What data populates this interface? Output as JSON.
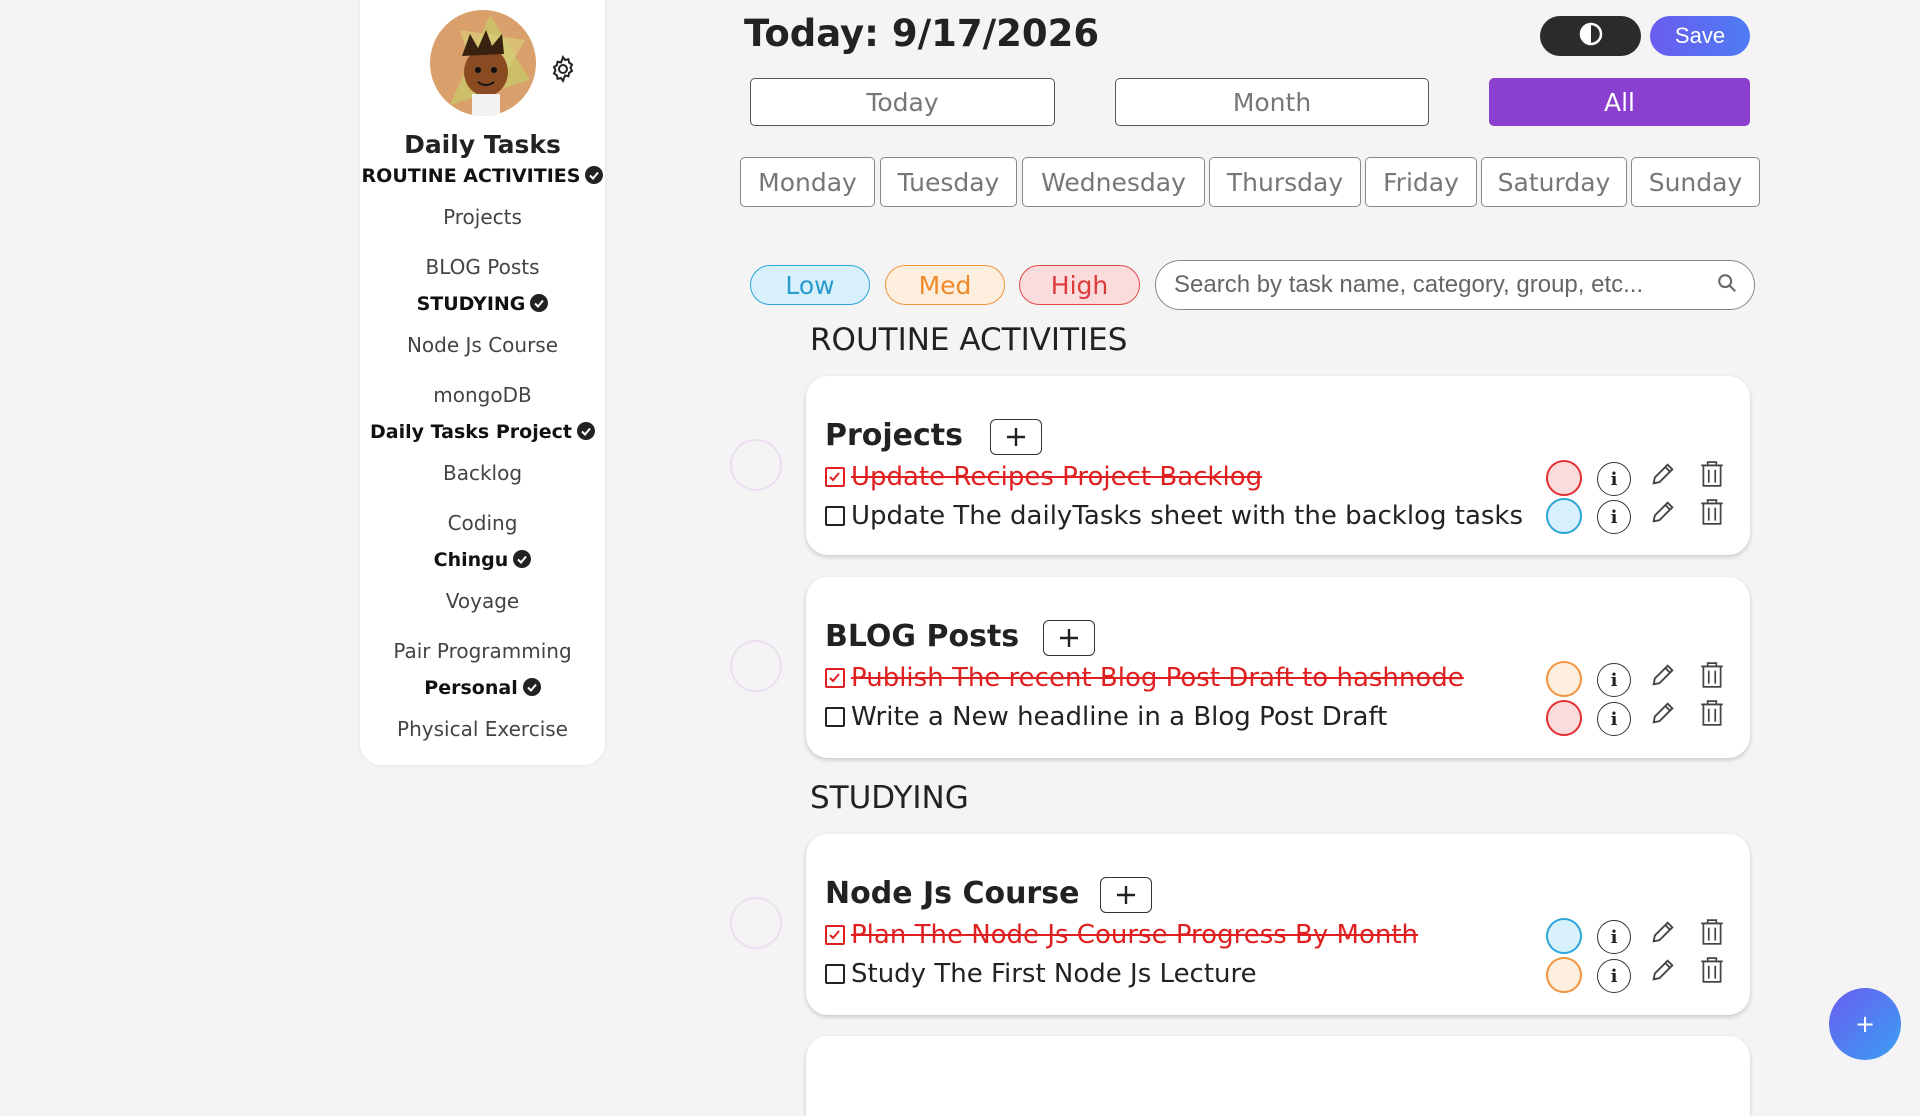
{
  "header": {
    "today_label": "Today: 9/17/2026",
    "save_label": "Save",
    "theme_icon": "contrast-icon"
  },
  "views": [
    "Today",
    "Month",
    "All"
  ],
  "active_view": "All",
  "days": [
    "Monday",
    "Tuesday",
    "Wednesday",
    "Thursday",
    "Friday",
    "Saturday",
    "Sunday"
  ],
  "priorities": {
    "low": "Low",
    "med": "Med",
    "high": "High"
  },
  "colors": {
    "accent": "#8a3fcf",
    "low": "#2aa6d8",
    "med": "#f0953c",
    "high": "#e03030",
    "done": "#e02020"
  },
  "search": {
    "placeholder": "Search by task name, category, group, etc..."
  },
  "sidebar": {
    "title": "Daily Tasks",
    "groups": [
      {
        "name": "ROUTINE ACTIVITIES",
        "items": [
          "Projects",
          "BLOG Posts"
        ]
      },
      {
        "name": "STUDYING",
        "items": [
          "Node Js Course",
          "mongoDB"
        ]
      },
      {
        "name": "Daily Tasks Project",
        "items": [
          "Backlog",
          "Coding"
        ]
      },
      {
        "name": "Chingu",
        "items": [
          "Voyage",
          "Pair Programming"
        ]
      },
      {
        "name": "Personal",
        "items": [
          "Physical Exercise"
        ]
      }
    ]
  },
  "sections": [
    {
      "heading": "ROUTINE ACTIVITIES",
      "cards": [
        {
          "title": "Projects",
          "tasks": [
            {
              "text": "Update Recipes Project Backlog",
              "done": true,
              "priority": "high"
            },
            {
              "text": "Update The dailyTasks sheet with the backlog tasks",
              "done": false,
              "priority": "low"
            }
          ]
        },
        {
          "title": "BLOG Posts",
          "tasks": [
            {
              "text": "Publish The recent Blog Post Draft to hashnode",
              "done": true,
              "priority": "med"
            },
            {
              "text": "Write a New headline in a Blog Post Draft",
              "done": false,
              "priority": "high"
            }
          ]
        }
      ]
    },
    {
      "heading": "STUDYING",
      "cards": [
        {
          "title": "Node Js Course",
          "tasks": [
            {
              "text": "Plan The Node Js Course Progress By Month",
              "done": true,
              "priority": "low"
            },
            {
              "text": "Study The First Node Js Lecture",
              "done": false,
              "priority": "med"
            }
          ]
        }
      ]
    }
  ],
  "fab_label": "+"
}
